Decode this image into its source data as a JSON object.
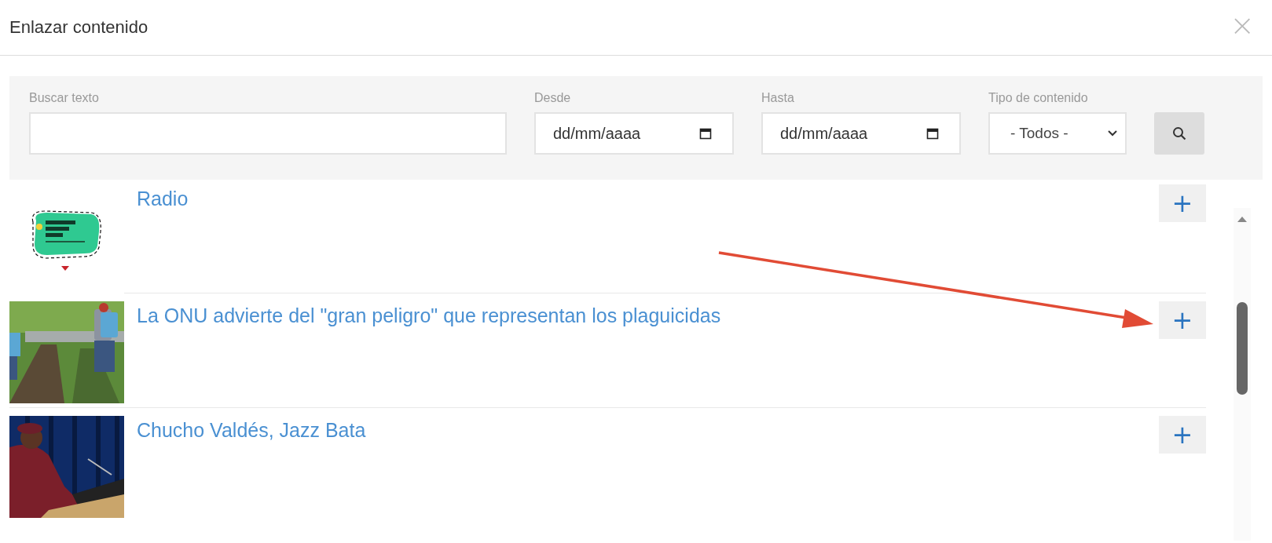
{
  "dialog": {
    "title": "Enlazar contenido",
    "close": "×"
  },
  "filters": {
    "search": {
      "label": "Buscar texto"
    },
    "from": {
      "label": "Desde",
      "placeholder": "dd/mm/aaaa"
    },
    "to": {
      "label": "Hasta",
      "placeholder": "dd/mm/aaaa"
    },
    "type": {
      "label": "Tipo de contenido",
      "value": "- Todos -"
    }
  },
  "results": [
    {
      "title": "Radio",
      "action": "+"
    },
    {
      "title": "La ONU advierte del \"gran peligro\" que representan los plaguicidas",
      "action": "+"
    },
    {
      "title": "Chucho Valdés, Jazz Bata",
      "action": "+"
    }
  ]
}
